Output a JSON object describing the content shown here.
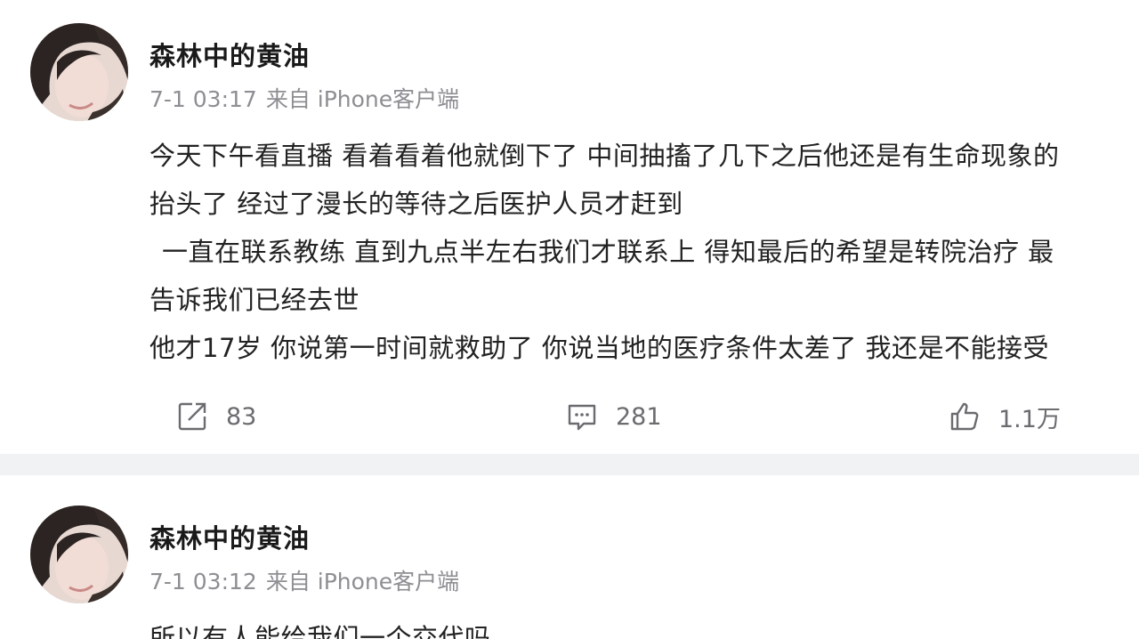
{
  "posts": [
    {
      "username": "森林中的黄油",
      "time": "7-1 03:17",
      "source": "来自 iPhone客户端",
      "lines": [
        "今天下午看直播 看着看着他就倒下了 中间抽搐了几下之后他还是有生命现象的",
        "抬头了 经过了漫长的等待之后医护人员才赶到",
        "一直在联系教练 直到九点半左右我们才联系上 得知最后的希望是转院治疗  最",
        "告诉我们已经去世",
        "他才17岁 你说第一时间就救助了 你说当地的医疗条件太差了 我还是不能接受"
      ],
      "actions": {
        "repost_icon": "share-icon",
        "repost_count": "83",
        "comment_icon": "comment-icon",
        "comment_count": "281",
        "like_icon": "thumbs-up-icon",
        "like_count": "1.1万"
      }
    },
    {
      "username": "森林中的黄油",
      "time": "7-1 03:12",
      "source": "来自 iPhone客户端",
      "lines": [
        "所以有人能给我们一个交代吗"
      ]
    }
  ],
  "colors": {
    "text_primary": "#222222",
    "text_meta": "#8e8e93",
    "separator": "#f1f2f4",
    "icon": "#6b6b70"
  }
}
